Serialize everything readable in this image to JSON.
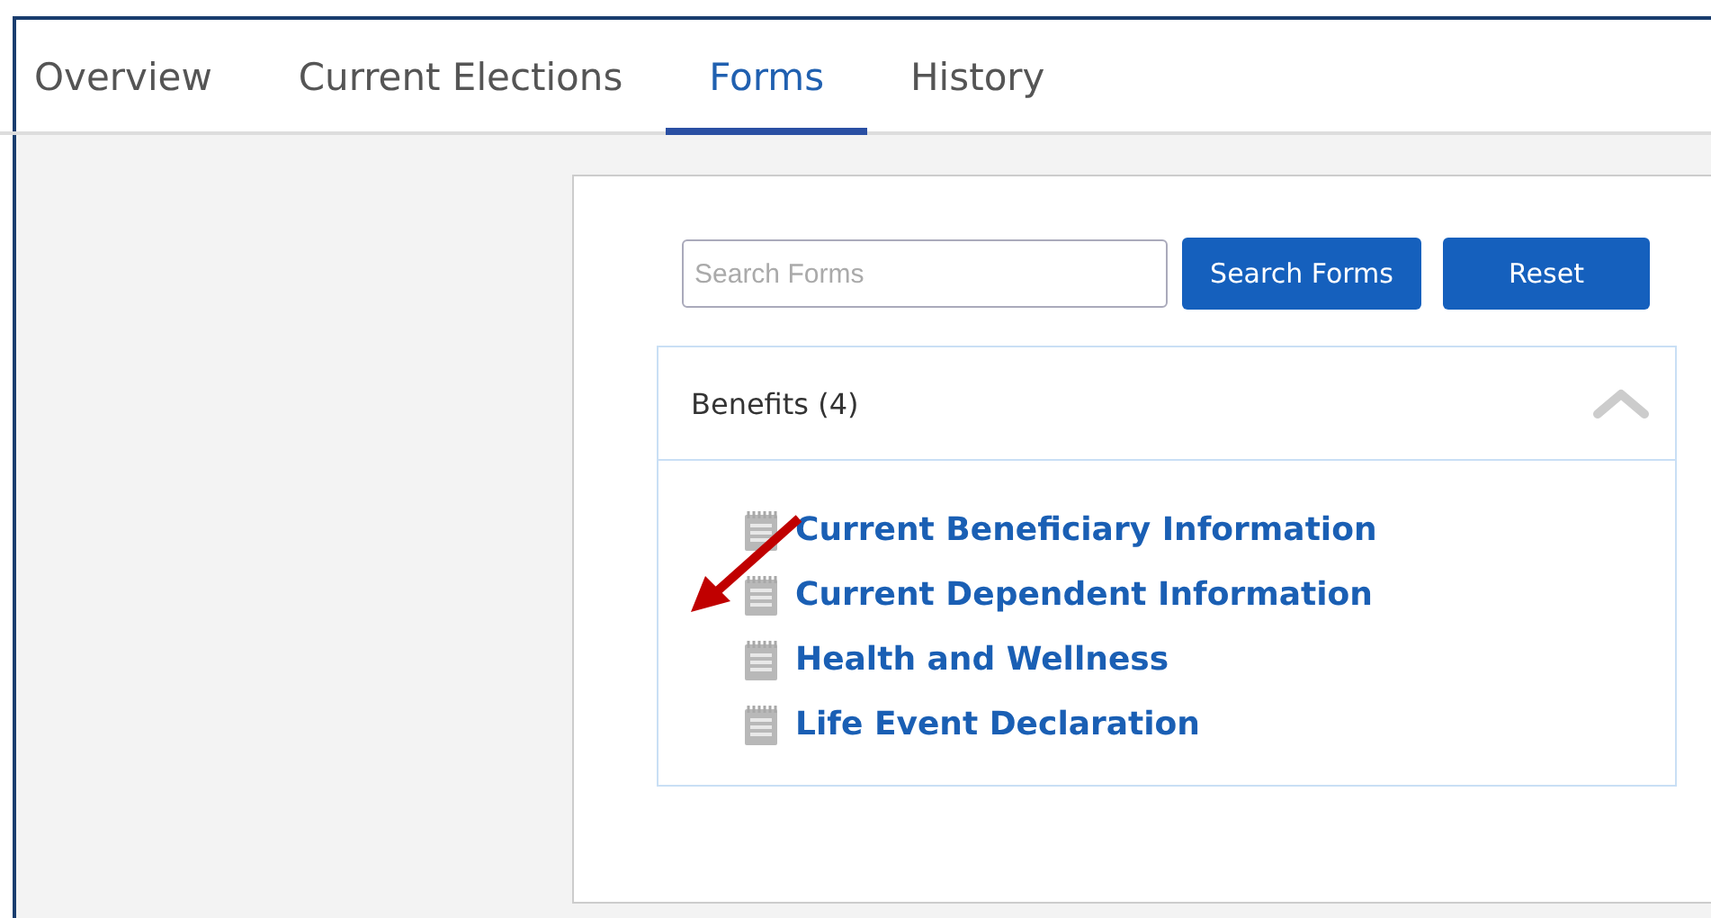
{
  "tabs": [
    {
      "label": "Overview",
      "selected": false
    },
    {
      "label": "Current Elections",
      "selected": false
    },
    {
      "label": "Forms",
      "selected": true
    },
    {
      "label": "History",
      "selected": false
    }
  ],
  "search": {
    "placeholder": "Search Forms"
  },
  "buttons": [
    "Search Forms",
    "Reset"
  ],
  "accordion": {
    "title": "Benefits (4)",
    "expanded": true,
    "items": [
      "Current Beneficiary Information",
      "Current Dependent Information",
      "Health and Wellness",
      "Life Event Declaration"
    ]
  }
}
